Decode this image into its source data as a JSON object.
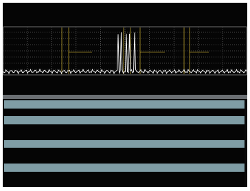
{
  "colors": {
    "background": "#050505",
    "group_header": "#7f9da5",
    "trace": "#f2f2f2",
    "grid": "#8a8a8a",
    "marker": "#f5d23a"
  },
  "header": {
    "line1": {
      "left": "",
      "mid": "",
      "right": ""
    },
    "line2": {
      "left": "",
      "mid": "",
      "right": ""
    }
  },
  "footer": {
    "line1": {
      "left": "",
      "right": ""
    },
    "line2": {
      "left": "",
      "mid": "",
      "right": ""
    }
  },
  "table": {
    "rows": [
      {
        "kind": "header",
        "cells": [
          "",
          "",
          "",
          ""
        ]
      },
      {
        "kind": "data",
        "cells": [
          "",
          "",
          "",
          ""
        ]
      },
      {
        "kind": "header",
        "cells": [
          "",
          "",
          "",
          ""
        ]
      },
      {
        "kind": "data",
        "cells": [
          "",
          "",
          "",
          ""
        ]
      },
      {
        "kind": "data",
        "cells": [
          "",
          "",
          "",
          ""
        ]
      },
      {
        "kind": "header",
        "cells": [
          "",
          "",
          "",
          ""
        ]
      },
      {
        "kind": "data",
        "cells": [
          "",
          "",
          "",
          ""
        ]
      },
      {
        "kind": "data",
        "cells": [
          "",
          "",
          "",
          ""
        ]
      },
      {
        "kind": "header",
        "cells": [
          "",
          "",
          "",
          ""
        ]
      },
      {
        "kind": "data",
        "cells": [
          "",
          "",
          "",
          ""
        ]
      },
      {
        "kind": "data",
        "cells": [
          "",
          "",
          "",
          ""
        ]
      }
    ]
  }
}
